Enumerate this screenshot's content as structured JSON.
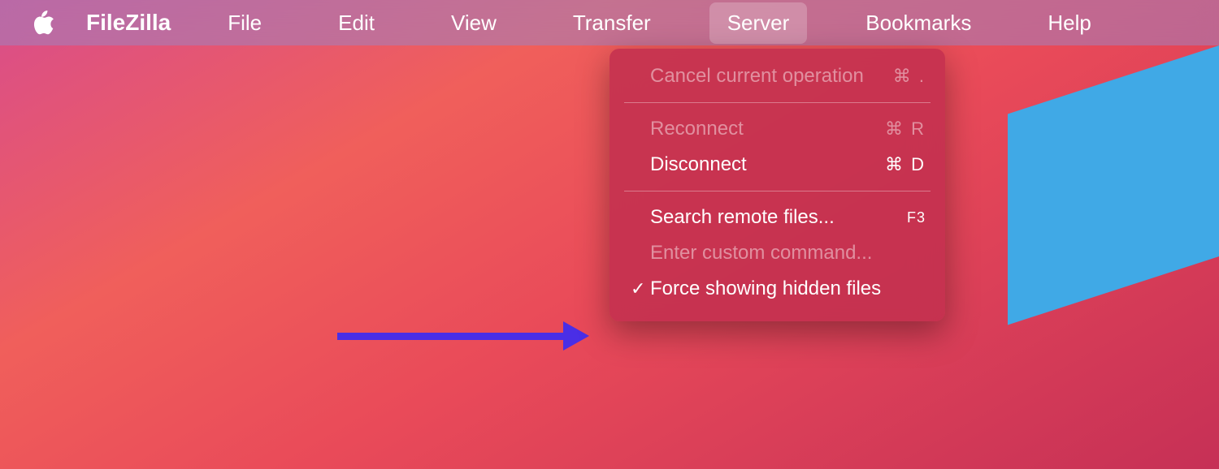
{
  "menubar": {
    "app": "FileZilla",
    "items": [
      "File",
      "Edit",
      "View",
      "Transfer",
      "Server",
      "Bookmarks",
      "Help"
    ],
    "active_index": 4
  },
  "dropdown": {
    "items": [
      {
        "label": "Cancel current operation",
        "shortcut": "⌘ .",
        "disabled": true,
        "checked": false
      },
      {
        "sep": true
      },
      {
        "label": "Reconnect",
        "shortcut": "⌘ R",
        "disabled": true,
        "checked": false
      },
      {
        "label": "Disconnect",
        "shortcut": "⌘ D",
        "disabled": false,
        "checked": false
      },
      {
        "sep": true
      },
      {
        "label": "Search remote files...",
        "shortcut": "F3",
        "shortcut_small": true,
        "disabled": false,
        "checked": false
      },
      {
        "label": "Enter custom command...",
        "shortcut": "",
        "disabled": true,
        "checked": false
      },
      {
        "label": "Force showing hidden files",
        "shortcut": "",
        "disabled": false,
        "checked": true
      }
    ]
  },
  "annotation": {
    "points_to": "Force showing hidden files"
  }
}
